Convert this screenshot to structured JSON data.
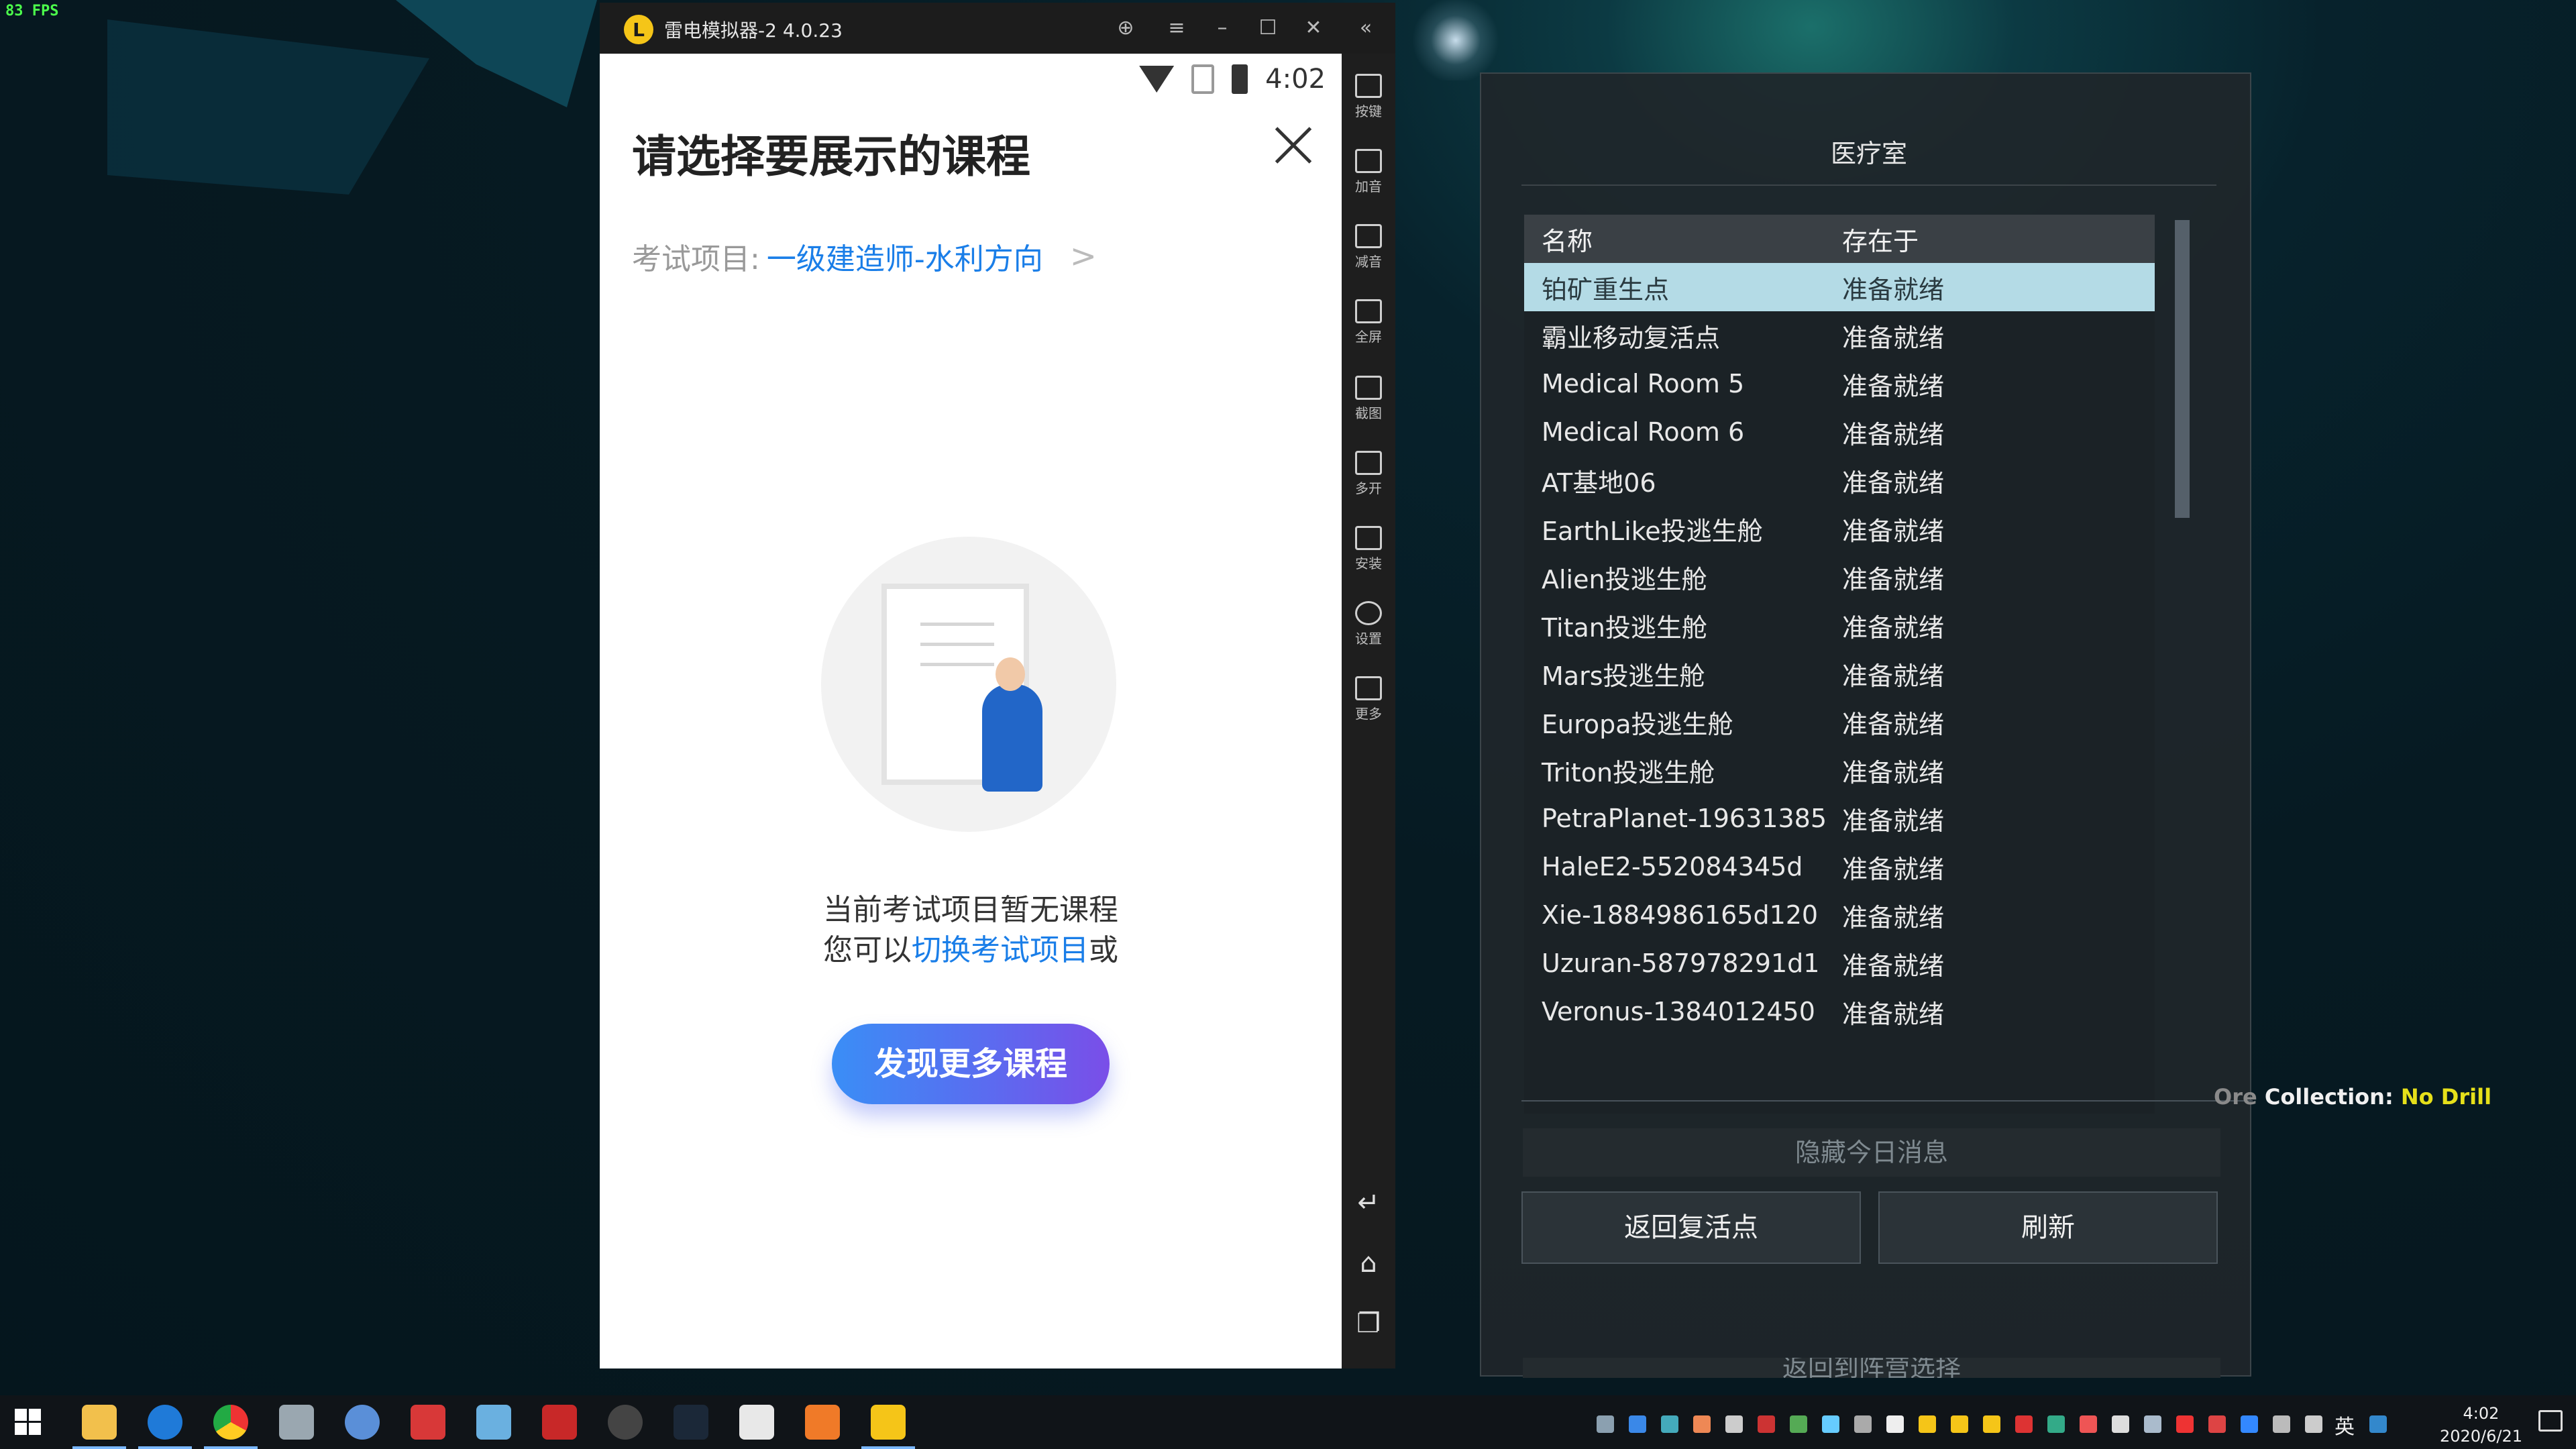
{
  "overlay": {
    "fps": "83 FPS"
  },
  "emulator": {
    "title": "雷电模拟器-2 4.0.23",
    "sidebar": [
      "按键",
      "加音",
      "减音",
      "全屏",
      "截图",
      "多开",
      "安装",
      "设置",
      "更多"
    ]
  },
  "phone": {
    "status_time": "4:02",
    "title": "请选择要展示的课程",
    "exam_label": "考试项目:",
    "exam_value": "一级建造师-水利方向",
    "empty_line1": "当前考试项目暂无课程",
    "empty_line2_prefix": "您可以",
    "empty_line2_link": "切换考试项目",
    "empty_line2_suffix": "或",
    "discover_button": "发现更多课程"
  },
  "game_panel": {
    "title": "医疗室",
    "headers": [
      "名称",
      "存在于"
    ],
    "rows": [
      {
        "name": "铂矿重生点",
        "status": "准备就绪",
        "selected": true
      },
      {
        "name": "霸业移动复活点",
        "status": "准备就绪"
      },
      {
        "name": "Medical Room 5",
        "status": "准备就绪"
      },
      {
        "name": "Medical Room 6",
        "status": "准备就绪"
      },
      {
        "name": "AT基地06",
        "status": "准备就绪"
      },
      {
        "name": "EarthLike投逃生舱",
        "status": "准备就绪"
      },
      {
        "name": "Alien投逃生舱",
        "status": "准备就绪"
      },
      {
        "name": "Titan投逃生舱",
        "status": "准备就绪"
      },
      {
        "name": "Mars投逃生舱",
        "status": "准备就绪"
      },
      {
        "name": "Europa投逃生舱",
        "status": "准备就绪"
      },
      {
        "name": "Triton投逃生舱",
        "status": "准备就绪"
      },
      {
        "name": "PetraPlanet-19631385",
        "status": "准备就绪"
      },
      {
        "name": "HaleE2-552084345d",
        "status": "准备就绪"
      },
      {
        "name": "Xie-1884986165d120",
        "status": "准备就绪"
      },
      {
        "name": "Uzuran-587978291d1",
        "status": "准备就绪"
      },
      {
        "name": "Veronus-1384012450",
        "status": "准备就绪"
      }
    ],
    "hide_today": "隐藏今日消息",
    "return_respawn": "返回复活点",
    "refresh": "刷新",
    "return_faction": "返回到阵营选择",
    "ore_label_dim": "Ore",
    "ore_label": " Collection: ",
    "ore_value": "No Drill"
  },
  "taskbar": {
    "ime": "英",
    "time": "4:02",
    "date": "2020/6/21"
  }
}
